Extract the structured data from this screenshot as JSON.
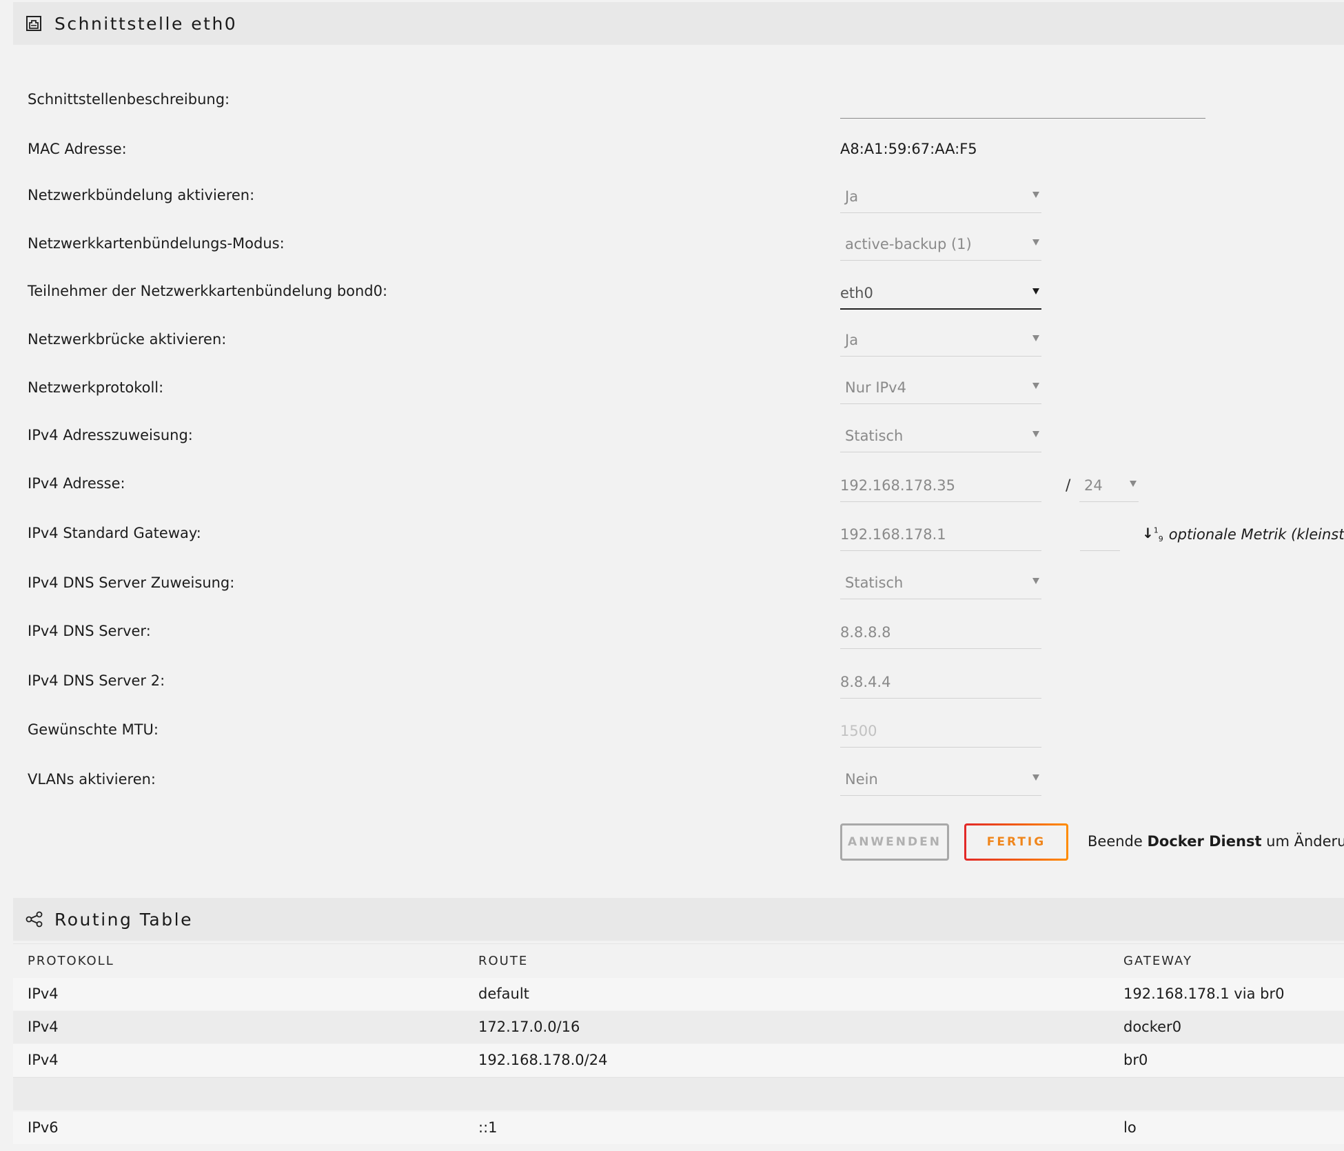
{
  "interface_section": {
    "icon": "ethernet-port-icon",
    "title": "Schnittstelle eth0"
  },
  "form": {
    "description": {
      "label": "Schnittstellenbeschreibung:",
      "value": ""
    },
    "mac": {
      "label": "MAC Adresse:",
      "value": "A8:A1:59:67:AA:F5"
    },
    "bonding_enable": {
      "label": "Netzwerkbündelung aktivieren:",
      "value": "Ja"
    },
    "bonding_mode": {
      "label": "Netzwerkkartenbündelungs-Modus:",
      "value": "active-backup (1)"
    },
    "bond_members": {
      "label": "Teilnehmer der Netzwerkkartenbündelung bond0:",
      "value": "eth0"
    },
    "bridge_enable": {
      "label": "Netzwerkbrücke aktivieren:",
      "value": "Ja"
    },
    "protocol": {
      "label": "Netzwerkprotokoll:",
      "value": "Nur IPv4"
    },
    "ipv4_assignment": {
      "label": "IPv4 Adresszuweisung:",
      "value": "Statisch"
    },
    "ipv4_address": {
      "label": "IPv4 Adresse:",
      "value": "192.168.178.35",
      "separator": "/",
      "prefix": "24"
    },
    "ipv4_gateway": {
      "label": "IPv4 Standard Gateway:",
      "value": "192.168.178.1",
      "metric": "",
      "metric_hint": "optionale Metrik (kleinste",
      "metric_icon": "sort-numeric-icon"
    },
    "ipv4_dns_assignment": {
      "label": "IPv4 DNS Server Zuweisung:",
      "value": "Statisch"
    },
    "ipv4_dns1": {
      "label": "IPv4 DNS Server:",
      "value": "8.8.8.8"
    },
    "ipv4_dns2": {
      "label": "IPv4 DNS Server 2:",
      "value": "8.8.4.4"
    },
    "mtu": {
      "label": "Gewünschte MTU:",
      "placeholder": "1500"
    },
    "vlans_enable": {
      "label": "VLANs aktivieren:",
      "value": "Nein"
    }
  },
  "actions": {
    "apply_label": "ANWENDEN",
    "done_label": "FERTIG",
    "notice_prefix": "Beende",
    "notice_bold": "Docker Dienst",
    "notice_suffix": "um Änderung"
  },
  "routing_section": {
    "icon": "share-nodes-icon",
    "title": "Routing Table",
    "columns": [
      "PROTOKOLL",
      "ROUTE",
      "GATEWAY"
    ],
    "rows": [
      {
        "protocol": "IPv4",
        "route": "default",
        "gateway": "192.168.178.1 via br0"
      },
      {
        "protocol": "IPv4",
        "route": "172.17.0.0/16",
        "gateway": "docker0"
      },
      {
        "protocol": "IPv4",
        "route": "192.168.178.0/24",
        "gateway": "br0"
      },
      {
        "protocol": "",
        "route": "",
        "gateway": ""
      },
      {
        "protocol": "IPv6",
        "route": "::1",
        "gateway": "lo"
      }
    ]
  },
  "colors": {
    "page_bg": "#f2f2f2",
    "header_bg": "#e8e8e8",
    "done_gradient_start": "#e22828",
    "done_gradient_end": "#ff8d00",
    "done_text": "#f0861c",
    "apply_border": "#a8a8a8"
  }
}
